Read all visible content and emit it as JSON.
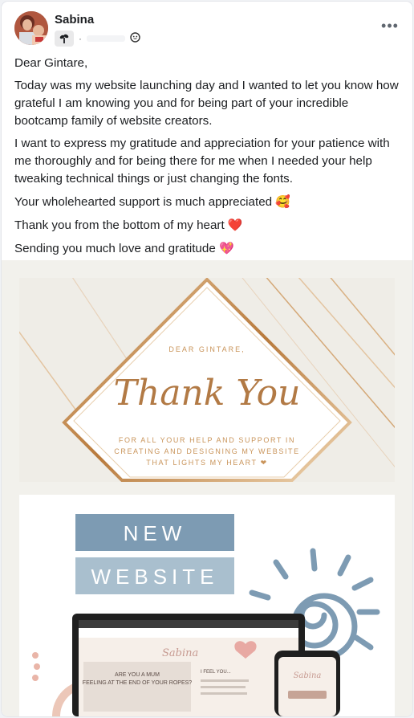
{
  "post": {
    "author": "Sabina",
    "meta_separator": "·",
    "paragraphs": [
      "Dear Gintare,",
      "Today was my website launching day and I wanted to let you know how grateful I am knowing you and for being part of your incredible bootcamp family of website creators.",
      "I want to express my gratitude and appreciation for your patience with me thoroughly and for being there for me when I needed your help tweaking technical things or just changing the fonts.",
      "Your wholehearted support is much appreciated",
      "Thank you from the bottom of my heart",
      "Sending you much love and gratitude"
    ],
    "emojis": [
      "🥰",
      "❤️",
      "💖"
    ]
  },
  "thankyou_card": {
    "salutation": "DEAR GINTARE,",
    "script_title": "Thank You",
    "message_line1": "FOR ALL YOUR HELP AND SUPPORT IN",
    "message_line2": "CREATING AND DESIGNING MY WEBSITE",
    "message_line3": "THAT LIGHTS MY HEART ❤"
  },
  "website_card": {
    "banner_line1": "NEW",
    "banner_line2": "WEBSITE",
    "laptop_heading1": "ARE YOU A MUM",
    "laptop_heading2": "FEELING AT THE END OF YOUR ROPES?",
    "laptop_side_heading": "I FEEL YOU..."
  },
  "colors": {
    "banner_blue": "#7d9bb3",
    "banner_light": "#a9bfce",
    "gold": "#c9945a",
    "blush": "#e9b5a8"
  }
}
